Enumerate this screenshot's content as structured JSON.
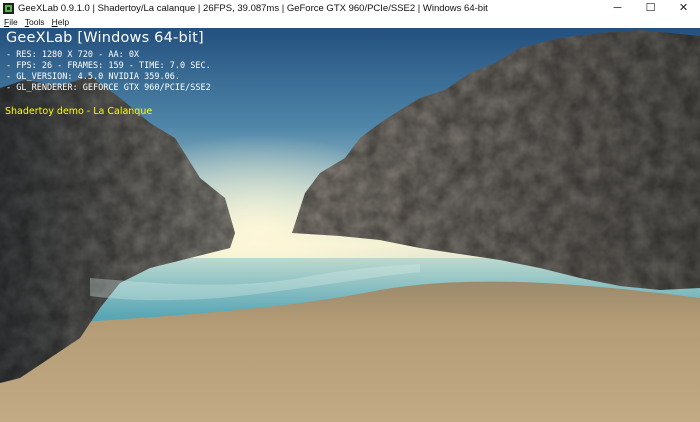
{
  "window": {
    "title": "GeeXLab 0.9.1.0 | Shadertoy/La calanque | 26FPS, 39.087ms | GeForce GTX 960/PCIe/SSE2 | Windows 64-bit",
    "app_icon": "geexlab-icon",
    "controls": {
      "minimize": "─",
      "maximize": "☐",
      "close": "✕"
    }
  },
  "menu": [
    {
      "accel": "F",
      "rest": "ile"
    },
    {
      "accel": "T",
      "rest": "ools"
    },
    {
      "accel": "H",
      "rest": "elp"
    }
  ],
  "hud": {
    "title": "GeeXLab [Windows 64-bit]",
    "res": "- RES: 1280 X 720 - AA: 0X",
    "fps": "- FPS: 26 - FRAMES: 159 - TIME: 7.0 SEC.",
    "gl_version": "- GL_VERSION: 4.5.0 NVIDIA 359.06.",
    "gl_renderer": "- GL_RENDERER: GEFORCE GTX 960/PCIE/SSE2",
    "demo": "Shadertoy demo - La Calanque",
    "text_color": "#ffffff",
    "demo_color": "#ffff00"
  },
  "scene": {
    "description_icon": "calanque-scene",
    "sky_top": "#2c5c8a",
    "horizon": "#e9ead2",
    "water": "#5fa5b0",
    "sand": "#b7a07a",
    "rock": "#7a7570"
  }
}
